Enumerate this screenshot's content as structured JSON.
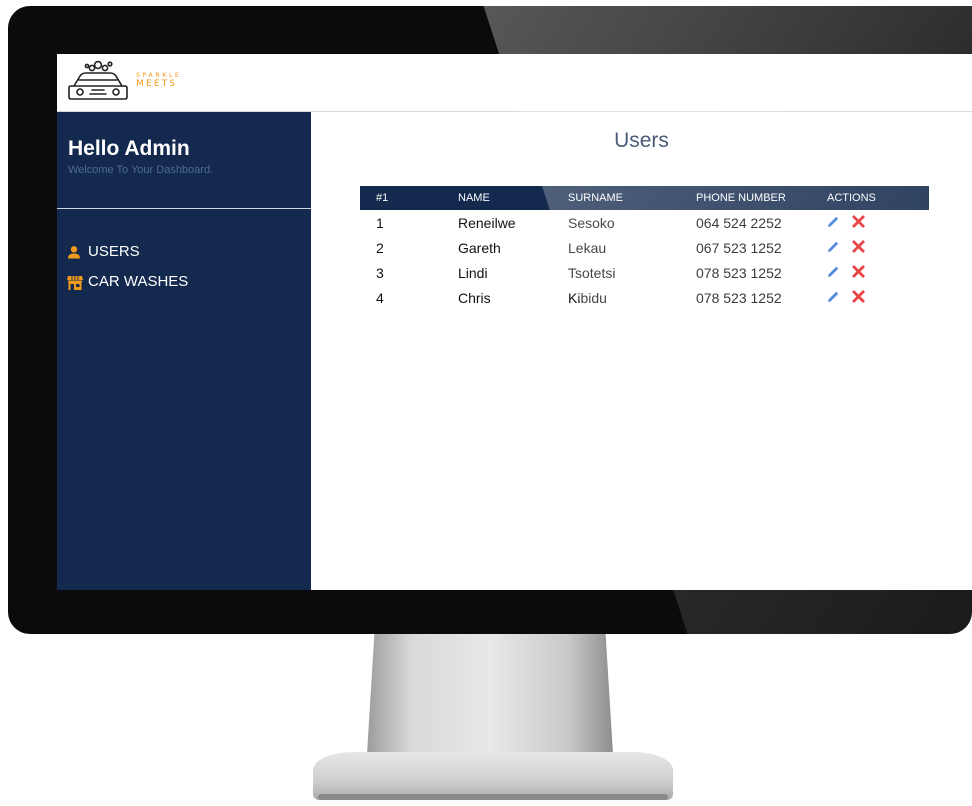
{
  "brand": {
    "line1": "SPARKLE",
    "line2": "MEETS"
  },
  "sidebar": {
    "greeting": "Hello Admin",
    "welcome": "Welcome To Your Dashboard.",
    "items": [
      {
        "label": "USERS",
        "icon": "user-icon"
      },
      {
        "label": "CAR WASHES",
        "icon": "store-icon"
      }
    ]
  },
  "main": {
    "title": "Users",
    "table": {
      "headers": [
        "#1",
        "NAME",
        "SURNAME",
        "PHONE NUMBER",
        "ACTIONS"
      ],
      "rows": [
        {
          "num": "1",
          "name": "Reneilwe",
          "surname": "Sesoko",
          "phone": "064 524 2252"
        },
        {
          "num": "2",
          "name": "Gareth",
          "surname": "Lekau",
          "phone": "067 523 1252"
        },
        {
          "num": "3",
          "name": "Lindi",
          "surname": "Tsotetsi",
          "phone": "078 523 1252"
        },
        {
          "num": "4",
          "name": "Chris",
          "surname": "Kibidu",
          "phone": "078 523 1252"
        }
      ]
    },
    "actions": {
      "edit_icon": "pencil-icon",
      "delete_icon": "close-icon"
    }
  },
  "colors": {
    "sidebar_bg": "#13294d",
    "accent_orange": "#f29a1b",
    "edit_blue": "#3b78d8",
    "delete_red": "#e52a2a"
  }
}
